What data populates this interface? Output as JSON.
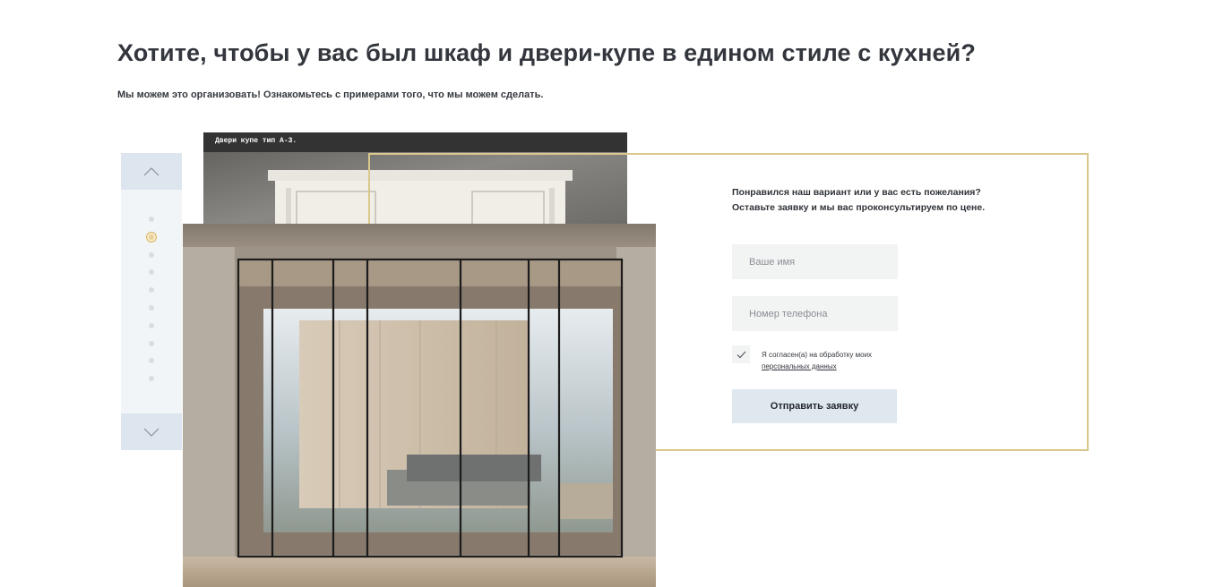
{
  "header": {
    "title": "Хотите, чтобы у вас был шкаф и двери-купе в едином стиле с кухней?",
    "subtitle": "Мы можем это организовать! Ознакомьтесь с примерами того, что мы можем сделать."
  },
  "slider": {
    "up_icon": "chevron-up-icon",
    "down_icon": "chevron-down-icon",
    "dot_count": 10,
    "active_dot": 2,
    "back_caption": "Двери купе тип А-3."
  },
  "form": {
    "intro_line1": "Понравился наш вариант или у вас есть пожелания?",
    "intro_line2": "Оставьте заявку и мы вас проконсультируем по цене.",
    "name_placeholder": "Ваше имя",
    "phone_placeholder": "Номер телефона",
    "consent_checked": true,
    "consent_text": "Я согласен(а) на обработку моих",
    "consent_link": "персональных данных",
    "submit_label": "Отправить заявку"
  },
  "colors": {
    "accent_gold": "#d9c78b",
    "nav_bg": "#dde6ee",
    "submit_bg": "#dfe7ef"
  }
}
